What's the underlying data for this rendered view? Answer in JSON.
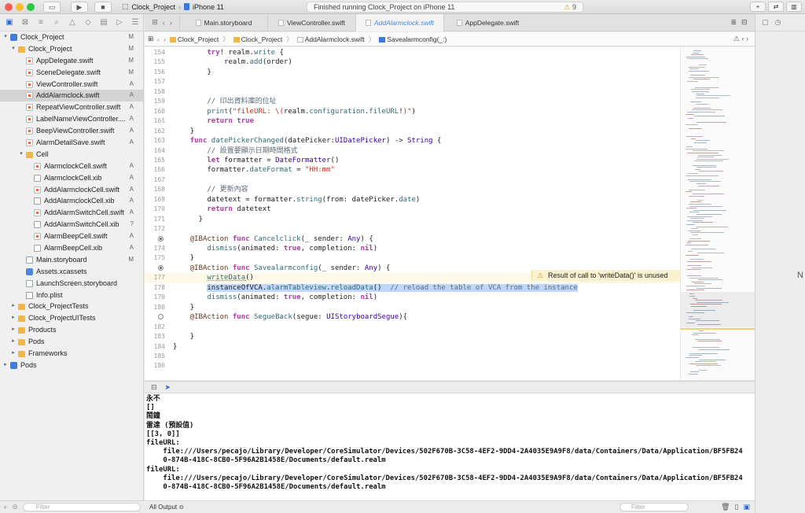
{
  "toolbar": {
    "scheme_name": "Clock_Project",
    "device_name": "iPhone 11",
    "status_text": "Finished running Clock_Project on iPhone 11",
    "warning_count": "9"
  },
  "navigator": {
    "filter_placeholder": "Filter",
    "items": [
      {
        "label": "Clock_Project",
        "badge": "M",
        "type": "proj",
        "indent": 0,
        "disclosure": "▾"
      },
      {
        "label": "Clock_Project",
        "badge": "M",
        "type": "folder",
        "indent": 1,
        "disclosure": "▾"
      },
      {
        "label": "AppDelegate.swift",
        "badge": "M",
        "type": "swift",
        "indent": 2,
        "disclosure": ""
      },
      {
        "label": "SceneDelegate.swift",
        "badge": "M",
        "type": "swift",
        "indent": 2,
        "disclosure": ""
      },
      {
        "label": "ViewController.swift",
        "badge": "A",
        "type": "swift",
        "indent": 2,
        "disclosure": ""
      },
      {
        "label": "AddAlarmclock.swift",
        "badge": "A",
        "type": "swift",
        "indent": 2,
        "disclosure": "",
        "selected": true
      },
      {
        "label": "RepeatViewController.swift",
        "badge": "A",
        "type": "swift",
        "indent": 2,
        "disclosure": ""
      },
      {
        "label": "LabelNameViewController....",
        "badge": "A",
        "type": "swift",
        "indent": 2,
        "disclosure": ""
      },
      {
        "label": "BeepViewController.swift",
        "badge": "A",
        "type": "swift",
        "indent": 2,
        "disclosure": ""
      },
      {
        "label": "AlarmDetailSave.swift",
        "badge": "A",
        "type": "swift",
        "indent": 2,
        "disclosure": ""
      },
      {
        "label": "Cell",
        "badge": "",
        "type": "folder",
        "indent": 2,
        "disclosure": "▾"
      },
      {
        "label": "AlarmclockCell.swift",
        "badge": "A",
        "type": "swift",
        "indent": 3,
        "disclosure": ""
      },
      {
        "label": "AlarmclockCell.xib",
        "badge": "A",
        "type": "xib",
        "indent": 3,
        "disclosure": ""
      },
      {
        "label": "AddAlarmclockCell.swift",
        "badge": "A",
        "type": "swift",
        "indent": 3,
        "disclosure": ""
      },
      {
        "label": "AddAlarmclockCell.xib",
        "badge": "A",
        "type": "xib",
        "indent": 3,
        "disclosure": ""
      },
      {
        "label": "AddAlarmSwitchCell.swift",
        "badge": "A",
        "type": "swift",
        "indent": 3,
        "disclosure": ""
      },
      {
        "label": "AddAlarmSwitchCell.xib",
        "badge": "?",
        "type": "xib",
        "indent": 3,
        "disclosure": ""
      },
      {
        "label": "AlarmBeepCell.swift",
        "badge": "A",
        "type": "swift",
        "indent": 3,
        "disclosure": ""
      },
      {
        "label": "AlarmBeepCell.xib",
        "badge": "A",
        "type": "xib",
        "indent": 3,
        "disclosure": ""
      },
      {
        "label": "Main.storyboard",
        "badge": "M",
        "type": "xib",
        "indent": 2,
        "disclosure": ""
      },
      {
        "label": "Assets.xcassets",
        "badge": "",
        "type": "assets",
        "indent": 2,
        "disclosure": ""
      },
      {
        "label": "LaunchScreen.storyboard",
        "badge": "",
        "type": "xib",
        "indent": 2,
        "disclosure": ""
      },
      {
        "label": "Info.plist",
        "badge": "",
        "type": "plist",
        "indent": 2,
        "disclosure": ""
      },
      {
        "label": "Clock_ProjectTests",
        "badge": "",
        "type": "folder",
        "indent": 1,
        "disclosure": "▸"
      },
      {
        "label": "Clock_ProjectUITests",
        "badge": "",
        "type": "folder",
        "indent": 1,
        "disclosure": "▸"
      },
      {
        "label": "Products",
        "badge": "",
        "type": "folder",
        "indent": 1,
        "disclosure": "▸"
      },
      {
        "label": "Pods",
        "badge": "",
        "type": "folder",
        "indent": 1,
        "disclosure": "▸"
      },
      {
        "label": "Frameworks",
        "badge": "",
        "type": "folder",
        "indent": 1,
        "disclosure": "▸"
      },
      {
        "label": "Pods",
        "badge": "",
        "type": "proj",
        "indent": 0,
        "disclosure": "▸"
      }
    ]
  },
  "tabs": [
    {
      "label": "Main.storyboard",
      "active": false
    },
    {
      "label": "ViewController.swift",
      "active": false
    },
    {
      "label": "AddAlarmclock.swift",
      "active": true
    },
    {
      "label": "AppDelegate.swift",
      "active": false
    }
  ],
  "jumpbar": {
    "crumbs": [
      "Clock_Project",
      "Clock_Project",
      "AddAlarmclock.swift",
      "Savealarmconfig(_:)"
    ]
  },
  "editor": {
    "warning_message": "Result of call to 'writeData()' is unused",
    "lines": [
      {
        "n": "154",
        "html": "        <span class=\"kw\">try</span>! realm.<span class=\"fn\">write</span> {"
      },
      {
        "n": "155",
        "html": "            realm.<span class=\"fn\">add</span>(order)"
      },
      {
        "n": "156",
        "html": "        }"
      },
      {
        "n": "157",
        "html": ""
      },
      {
        "n": "158",
        "html": ""
      },
      {
        "n": "159",
        "html": "        <span class=\"cm\">// 印出資料庫的位址</span>"
      },
      {
        "n": "160",
        "html": "        <span class=\"fn\">print</span>(<span class=\"str\">\"fileURL: \\(</span>realm.<span class=\"fn\">configuration</span>.<span class=\"fn\">fileURL</span>!<span class=\"str\">)\"</span>)"
      },
      {
        "n": "161",
        "html": "        <span class=\"kw\">return</span> <span class=\"kw\">true</span>"
      },
      {
        "n": "162",
        "html": "    }"
      },
      {
        "n": "163",
        "html": "    <span class=\"kw\">func</span> <span class=\"fn\">datePickerChanged</span>(datePicker:<span class=\"ty\">UIDatePicker</span>) -> <span class=\"ty\">String</span> {"
      },
      {
        "n": "164",
        "html": "        <span class=\"cm\">// 設置要顯示日期時間格式</span>"
      },
      {
        "n": "165",
        "html": "        <span class=\"kw\">let</span> formatter = <span class=\"ty\">DateFormatter</span>()"
      },
      {
        "n": "166",
        "html": "        formatter.<span class=\"fn\">dateFormat</span> = <span class=\"str\">\"HH:mm\"</span>"
      },
      {
        "n": "167",
        "html": ""
      },
      {
        "n": "168",
        "html": "        <span class=\"cm\">// 更新內容</span>"
      },
      {
        "n": "169",
        "html": "        datetext = formatter.<span class=\"fn\">string</span>(from: datePicker.<span class=\"fn\">date</span>)"
      },
      {
        "n": "170",
        "html": "        <span class=\"kw\">return</span> datetext"
      },
      {
        "n": "171",
        "html": "      }"
      },
      {
        "n": "172",
        "html": ""
      },
      {
        "n": "173",
        "html": "    <span class=\"at\">@IBAction</span> <span class=\"kw\">func</span> <span class=\"fn\">Cancelclick</span>(_ sender: <span class=\"ty\">Any</span>) {",
        "bp": "filled"
      },
      {
        "n": "174",
        "html": "        <span class=\"fn\">dismiss</span>(animated: <span class=\"kw\">true</span>, completion: <span class=\"kw\">nil</span>)"
      },
      {
        "n": "175",
        "html": "    }"
      },
      {
        "n": "176",
        "html": "    <span class=\"at\">@IBAction</span> <span class=\"kw\">func</span> <span class=\"fn\">Savealarmconfig</span>(_ sender: <span class=\"ty\">Any</span>) {",
        "bp": "filled"
      },
      {
        "n": "177",
        "html": "        <span style=\"text-decoration:underline dotted #b58d00\"><span class=\"fn\">writeData</span>()</span>",
        "warn": true
      },
      {
        "n": "178",
        "html": "        <span class=\"hl\">instanceOfVCA.<span class=\"fn\">alarmTableview</span>.<span class=\"fn\">reloadData</span>()  <span class=\"cm\">// reload the table of VCA from the instance</span></span>"
      },
      {
        "n": "179",
        "html": "        <span class=\"fn\">dismiss</span>(animated: <span class=\"kw\">true</span>, completion: <span class=\"kw\">nil</span>)"
      },
      {
        "n": "180",
        "html": "    }"
      },
      {
        "n": "181",
        "html": "    <span class=\"at\">@IBAction</span> <span class=\"kw\">func</span> <span class=\"fn\">SegueBack</span>(segue: <span class=\"ty\">UIStoryboardSegue</span>){",
        "bp": "empty"
      },
      {
        "n": "182",
        "html": ""
      },
      {
        "n": "183",
        "html": "    }"
      },
      {
        "n": "184",
        "html": "}"
      },
      {
        "n": "185",
        "html": ""
      },
      {
        "n": "186",
        "html": ""
      }
    ]
  },
  "console": {
    "output_selector": "All Output ≎",
    "filter_placeholder": "Filter",
    "lines": [
      "永不",
      "[]",
      "鬧鐘",
      "雷達 (預設值)",
      "[[3, 0]]",
      "fileURL:",
      "    file:///Users/pecajo/Library/Developer/CoreSimulator/Devices/502F670B-3C58-4EF2-9DD4-2A4035E9A9F8/data/Containers/Data/Application/BF5FB24",
      "    0-874B-418C-8CB0-5F96A2B1458E/Documents/default.realm",
      "fileURL:",
      "    file:///Users/pecajo/Library/Developer/CoreSimulator/Devices/502F670B-3C58-4EF2-9DD4-2A4035E9A9F8/data/Containers/Data/Application/BF5FB24",
      "    0-874B-418C-8CB0-5F96A2B1458E/Documents/default.realm"
    ]
  },
  "inspector": {
    "partial_text": "N"
  }
}
